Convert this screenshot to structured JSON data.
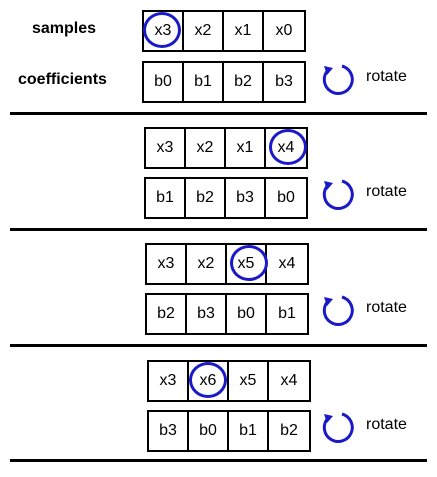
{
  "labels": {
    "samples": "samples",
    "coefficients": "coefficients"
  },
  "rotate_label": "rotate",
  "accent_color": "#1919c8",
  "steps": [
    {
      "samples": [
        "x3",
        "x2",
        "x1",
        "x0"
      ],
      "highlight_index": 0,
      "coefficients": [
        "b0",
        "b1",
        "b2",
        "b3"
      ]
    },
    {
      "samples": [
        "x3",
        "x2",
        "x1",
        "x4"
      ],
      "highlight_index": 3,
      "coefficients": [
        "b1",
        "b2",
        "b3",
        "b0"
      ]
    },
    {
      "samples": [
        "x3",
        "x2",
        "x5",
        "x4"
      ],
      "highlight_index": 2,
      "coefficients": [
        "b2",
        "b3",
        "b0",
        "b1"
      ]
    },
    {
      "samples": [
        "x3",
        "x6",
        "x5",
        "x4"
      ],
      "highlight_index": 1,
      "coefficients": [
        "b3",
        "b0",
        "b1",
        "b2"
      ]
    }
  ]
}
